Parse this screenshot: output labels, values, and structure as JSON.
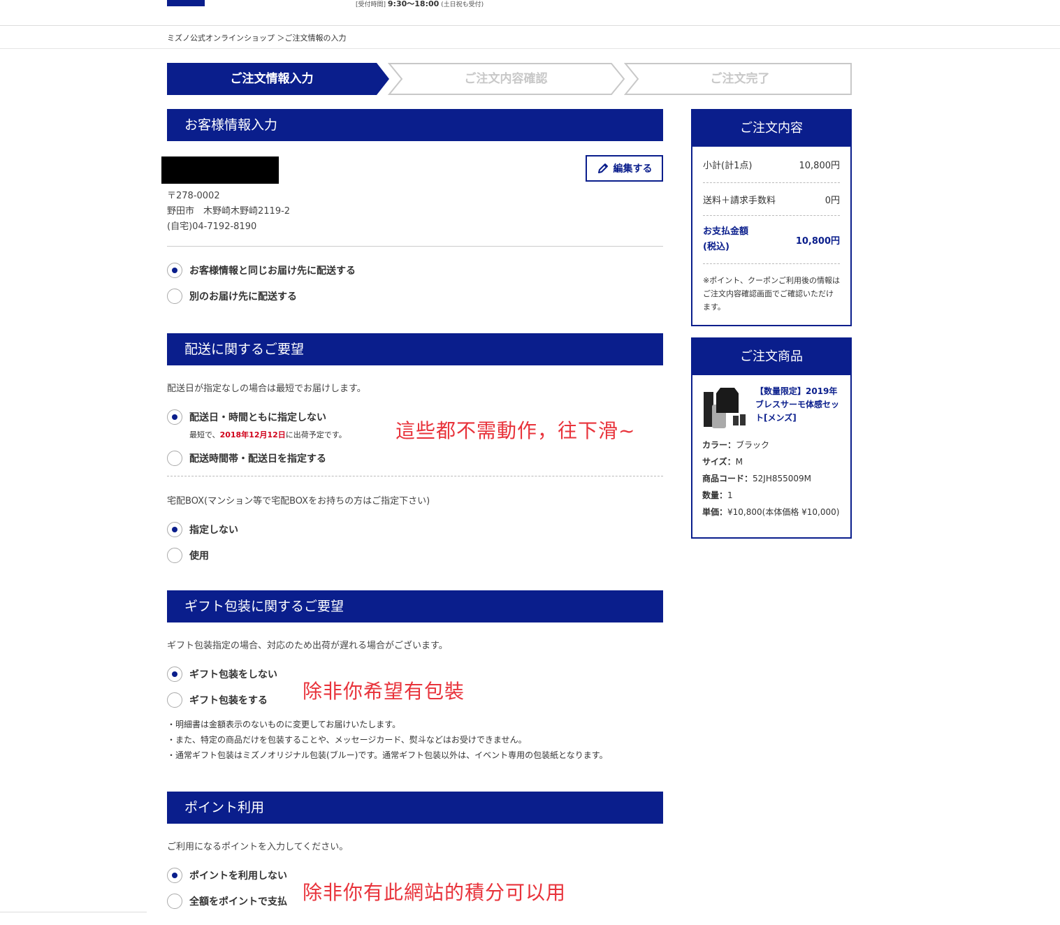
{
  "header": {
    "hours_label": "[受付時間]",
    "hours_time": "9:30〜18:00",
    "hours_note": "(土日祝も受付)"
  },
  "breadcrumb": "ミズノ公式オンラインショップ ＞ご注文情報の入力",
  "steps": [
    {
      "label": "ご注文情報入力",
      "active": true
    },
    {
      "label": "ご注文内容確認",
      "active": false
    },
    {
      "label": "ご注文完了",
      "active": false
    }
  ],
  "customer": {
    "heading": "お客様情報入力",
    "edit_label": "編集する",
    "postal": "〒278-0002",
    "address": "野田市　木野崎木野崎2119-2",
    "phone": "(自宅)04-7192-8190",
    "options": [
      {
        "label": "お客様情報と同じお届け先に配送する",
        "selected": true
      },
      {
        "label": "別のお届け先に配送する",
        "selected": false
      }
    ]
  },
  "delivery": {
    "heading": "配送に関するご要望",
    "note": "配送日が指定なしの場合は最短でお届けします。",
    "opt1_label": "配送日・時間ともに指定しない",
    "opt1_sub_prefix": "最短で、",
    "opt1_sub_date": "2018年12月12日",
    "opt1_sub_suffix": "に出荷予定です。",
    "opt2_label": "配送時間帯・配送日を指定する",
    "box_note": "宅配BOX(マンション等で宅配BOXをお持ちの方はご指定下さい)",
    "box_options": [
      {
        "label": "指定しない",
        "selected": true
      },
      {
        "label": "使用",
        "selected": false
      }
    ]
  },
  "gift": {
    "heading": "ギフト包装に関するご要望",
    "note": "ギフト包装指定の場合、対応のため出荷が遅れる場合がございます。",
    "options": [
      {
        "label": "ギフト包装をしない",
        "selected": true
      },
      {
        "label": "ギフト包装をする",
        "selected": false
      }
    ],
    "bullets": [
      "・明細書は金額表示のないものに変更してお届けいたします。",
      "・また、特定の商品だけを包装することや、メッセージカード、熨斗などはお受けできません。",
      "・通常ギフト包装はミズノオリジナル包装(ブルー)です。通常ギフト包装以外は、イベント専用の包装紙となります。"
    ]
  },
  "points": {
    "heading": "ポイント利用",
    "note": "ご利用になるポイントを入力してください。",
    "options": [
      {
        "label": "ポイントを利用しない",
        "selected": true
      },
      {
        "label": "全額をポイントで支払",
        "selected": false
      }
    ]
  },
  "annotations": {
    "a1": "這些都不需動作，往下滑~",
    "a2": "除非你希望有包裝",
    "a3": "除非你有此網站的積分可以用"
  },
  "order_summary": {
    "heading": "ご注文内容",
    "subtotal_label": "小計(計1点)",
    "subtotal_value": "10,800円",
    "shipping_label": "送料＋請求手数料",
    "shipping_value": "0円",
    "total_label_1": "お支払金額",
    "total_label_2": "(税込)",
    "total_value": "10,800円",
    "note": "※ポイント、クーポンご利用後の情報はご注文内容確認画面でご確認いただけます。"
  },
  "order_items": {
    "heading": "ご注文商品",
    "name": "【数量限定】2019年ブレスサーモ体感セット[メンズ]",
    "color_label": "カラー：",
    "color": "ブラック",
    "size_label": "サイズ：",
    "size": "M",
    "code_label": "商品コード：",
    "code": "52JH855009M",
    "qty_label": "数量：",
    "qty": "1",
    "price_label": "単価：",
    "price": "¥10,800(本体価格 ¥10,000)"
  },
  "colors": {
    "brand": "#0a1e8c",
    "annotation": "#e8333b",
    "highlight": "#d0021b"
  }
}
